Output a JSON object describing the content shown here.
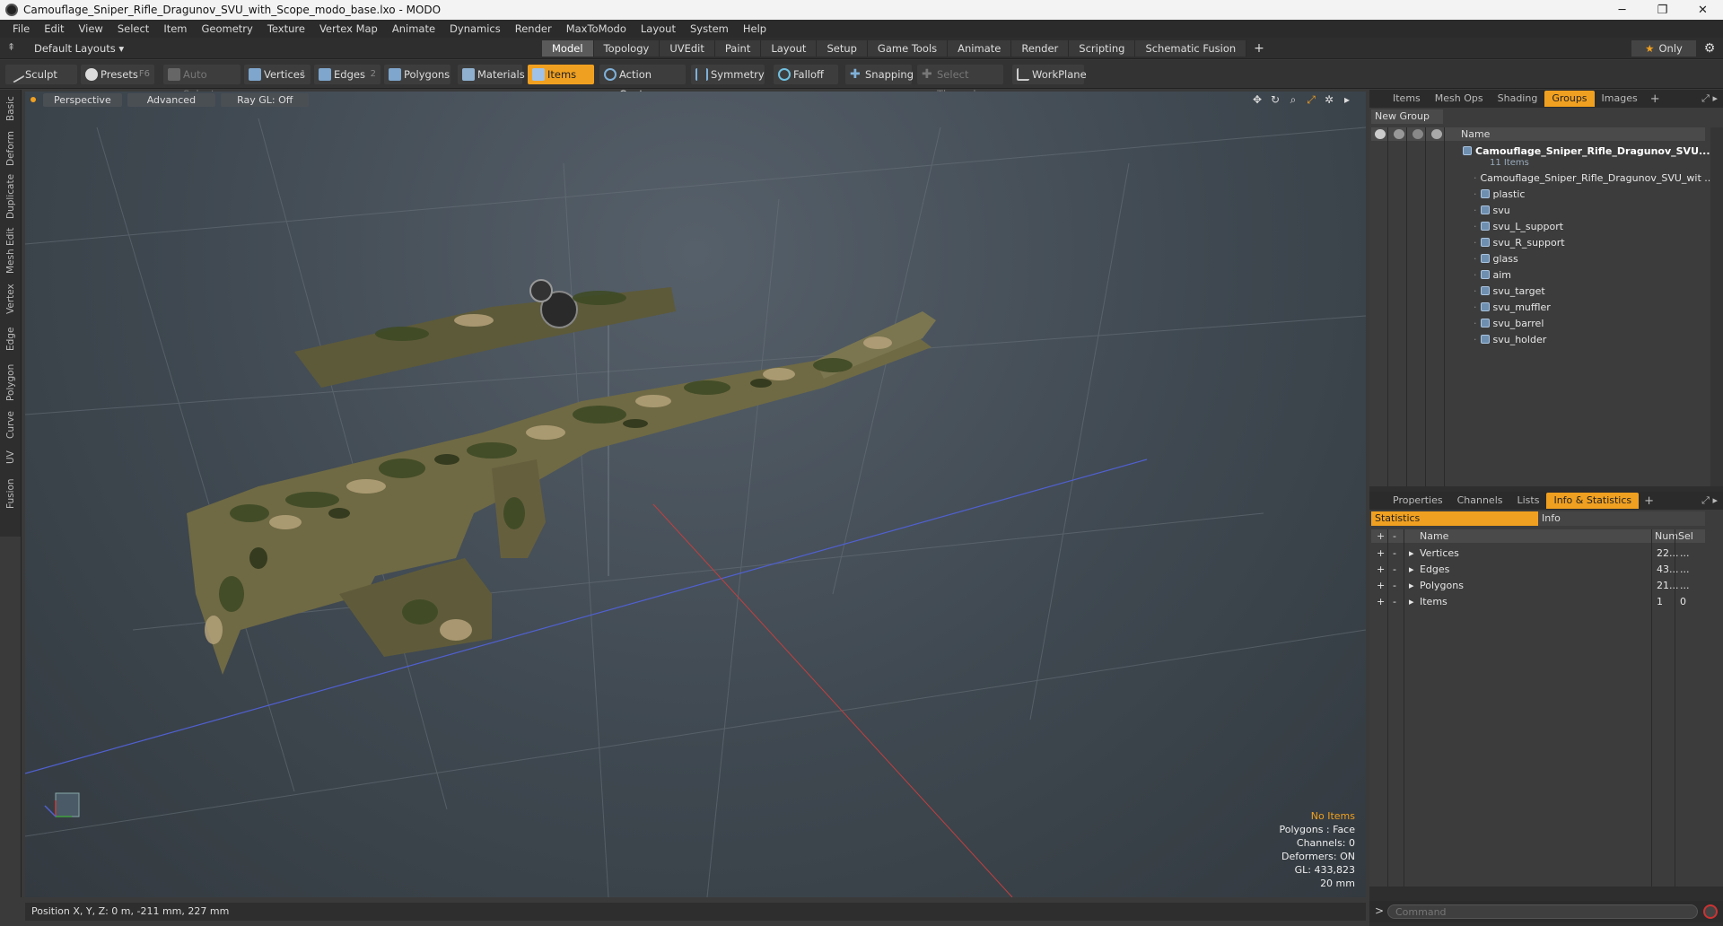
{
  "window": {
    "title": "Camouflage_Sniper_Rifle_Dragunov_SVU_with_Scope_modo_base.lxo - MODO",
    "minimize": "─",
    "maximize": "❐",
    "close": "✕"
  },
  "menu": [
    "File",
    "Edit",
    "View",
    "Select",
    "Item",
    "Geometry",
    "Texture",
    "Vertex Map",
    "Animate",
    "Dynamics",
    "Render",
    "MaxToModo",
    "Layout",
    "System",
    "Help"
  ],
  "layoutbar": {
    "layouts_label": "Default Layouts ▾",
    "tabs": [
      "Model",
      "Topology",
      "UVEdit",
      "Paint",
      "Layout",
      "Setup",
      "Game Tools",
      "Animate",
      "Render",
      "Scripting",
      "Schematic Fusion"
    ],
    "active_tab": "Model",
    "add": "+",
    "only_label": "Only",
    "star": "★",
    "gear": "⚙"
  },
  "toolbar": {
    "sculpt": "Sculpt",
    "presets": "Presets",
    "presets_key": "F6",
    "auto_select": "Auto Select",
    "vertices": "Vertices",
    "vertices_key": "1",
    "edges": "Edges",
    "edges_key": "2",
    "polygons": "Polygons",
    "materials": "Materials",
    "items": "Items",
    "action_center": "Action Center",
    "symmetry": "Symmetry",
    "falloff": "Falloff",
    "snapping": "Snapping",
    "select_through": "Select Through",
    "workplane": "WorkPlane"
  },
  "left_tabs": [
    "Basic",
    "Deform",
    "Duplicate",
    "Mesh Edit",
    "Vertex",
    "Edge",
    "Polygon",
    "Curve",
    "UV",
    "Fusion"
  ],
  "viewport": {
    "perspective": "Perspective",
    "advanced": "Advanced",
    "raygl": "Ray GL: Off",
    "stats": {
      "no_items": "No Items",
      "polygons": "Polygons : Face",
      "channels": "Channels: 0",
      "deformers": "Deformers: ON",
      "gl": "GL: 433,823",
      "scale": "20 mm"
    }
  },
  "status": {
    "position": "Position X, Y, Z:  0 m, -211 mm, 227 mm"
  },
  "groups_panel": {
    "tabs": [
      "Items",
      "Mesh Ops",
      "Shading",
      "Groups",
      "Images"
    ],
    "active_tab": "Groups",
    "new_group": "New Group",
    "column_name": "Name",
    "group_name": "Camouflage_Sniper_Rifle_Dragunov_SVU...",
    "group_count": "11 Items",
    "root_item": "Camouflage_Sniper_Rifle_Dragunov_SVU_wit ...",
    "items": [
      "plastic",
      "svu",
      "svu_L_support",
      "svu_R_support",
      "glass",
      "aim",
      "svu_target",
      "svu_muffler",
      "svu_barrel",
      "svu_holder"
    ]
  },
  "info_panel": {
    "tabs": [
      "Properties",
      "Channels",
      "Lists",
      "Info & Statistics"
    ],
    "active_tab": "Info & Statistics",
    "subtabs": [
      "Statistics",
      "Info"
    ],
    "columns": {
      "name": "Name",
      "num": "Num",
      "sel": "Sel"
    },
    "rows": [
      {
        "name": "Vertices",
        "num": "22...",
        "sel": "..."
      },
      {
        "name": "Edges",
        "num": "43...",
        "sel": "..."
      },
      {
        "name": "Polygons",
        "num": "21...",
        "sel": "..."
      },
      {
        "name": "Items",
        "num": "1",
        "sel": "0"
      }
    ]
  },
  "command": {
    "prompt": ">",
    "placeholder": "Command"
  }
}
